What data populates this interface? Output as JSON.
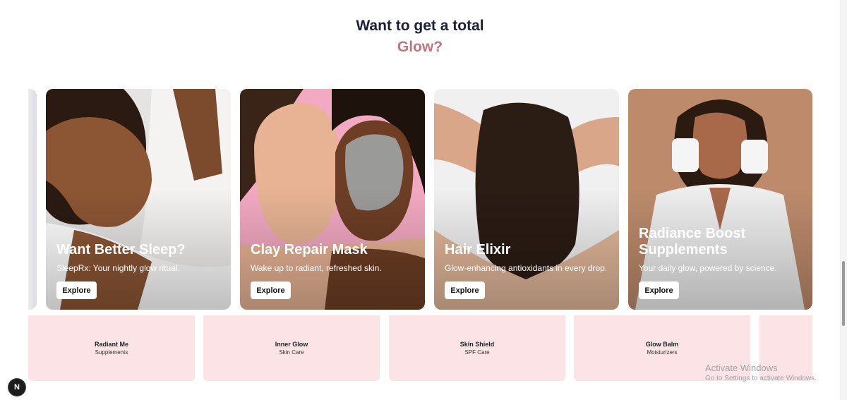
{
  "heading": {
    "line1": "Want to get a total",
    "line2": "Glow?"
  },
  "cards": [
    {
      "title": "Want Better Sleep?",
      "subtitle": "SleepRx: Your nightly glow ritual.",
      "button": "Explore"
    },
    {
      "title": "Clay Repair Mask",
      "subtitle": "Wake up to radiant, refreshed skin.",
      "button": "Explore"
    },
    {
      "title": "Hair Elixir",
      "subtitle": "Glow-enhancing antioxidants in every drop.",
      "button": "Explore"
    },
    {
      "title": "Radiance Boost Supplements",
      "subtitle": "Your daily glow, powered by science.",
      "button": "Explore"
    }
  ],
  "tiles": [
    {
      "name": "Radiant Me",
      "category": "Supplements"
    },
    {
      "name": "Inner Glow",
      "category": "Skin Care"
    },
    {
      "name": "Skin Shield",
      "category": "SPF Care"
    },
    {
      "name": "Glow Balm",
      "category": "Moisturizers"
    }
  ],
  "watermark": {
    "line1": "Activate Windows",
    "line2": "Go to Settings to activate Windows."
  },
  "badge": {
    "letter": "N"
  },
  "colors": {
    "heading": "#1a1f3c",
    "accent": "#c07680",
    "tile_bg": "#fbe3e6"
  }
}
